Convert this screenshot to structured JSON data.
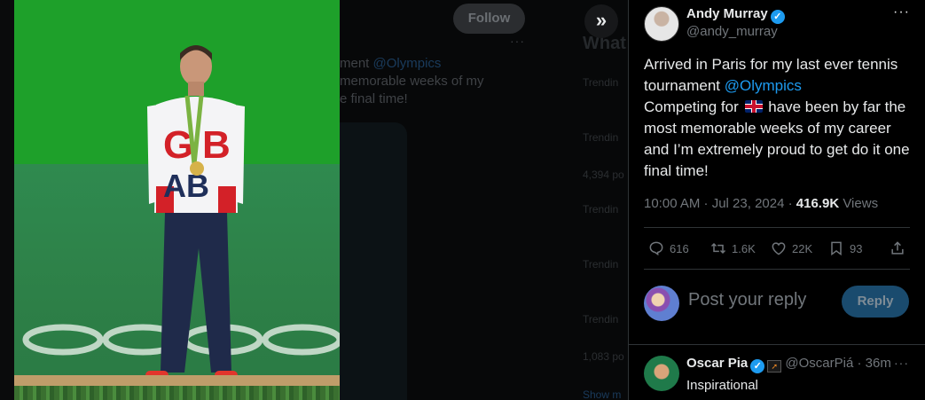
{
  "background": {
    "follow_label": "Follow",
    "text_prefix": "ment ",
    "text_mention": "@Olympics",
    "text_line2": "memorable weeks of my",
    "text_line3": "e final time!",
    "side_items": [
      "What",
      "Trendin",
      "Trendin",
      "4,394 po",
      "Trendin",
      "Trendin",
      "Trendin",
      "1,083 po",
      "Show m"
    ]
  },
  "tweet": {
    "author_name": "Andy Murray",
    "author_handle": "@andy_murray",
    "text_part1": "Arrived in Paris for my last ever tennis tournament ",
    "mention": "@Olympics",
    "text_part2": "Competing for ",
    "text_part3": " have been by far the most memorable weeks of my career and I’m extremely proud to get do it one final time!",
    "time": "10:00 AM · Jul 23, 2024 · ",
    "views_count": "416.9K",
    "views_label": " Views",
    "stats": {
      "replies": "616",
      "reposts": "1.6K",
      "likes": "22K",
      "bookmarks": "93"
    }
  },
  "reply_box": {
    "placeholder": "Post your reply",
    "button_label": "Reply"
  },
  "comment": {
    "name": "Oscar Pia",
    "handle": "@OscarPiá",
    "time": " · 36m",
    "text": "Inspirational"
  },
  "colors": {
    "accent": "#1d9bf0",
    "background": "#000000",
    "muted_text": "#71767b",
    "reply_button": "#1a4b6e"
  },
  "icons": {
    "expand": "double-chevron-right-icon",
    "verified": "verified-badge-icon",
    "more": "more-dots-icon",
    "reply": "reply-icon",
    "repost": "repost-icon",
    "like": "heart-icon",
    "bookmark": "bookmark-icon",
    "share": "share-icon"
  }
}
